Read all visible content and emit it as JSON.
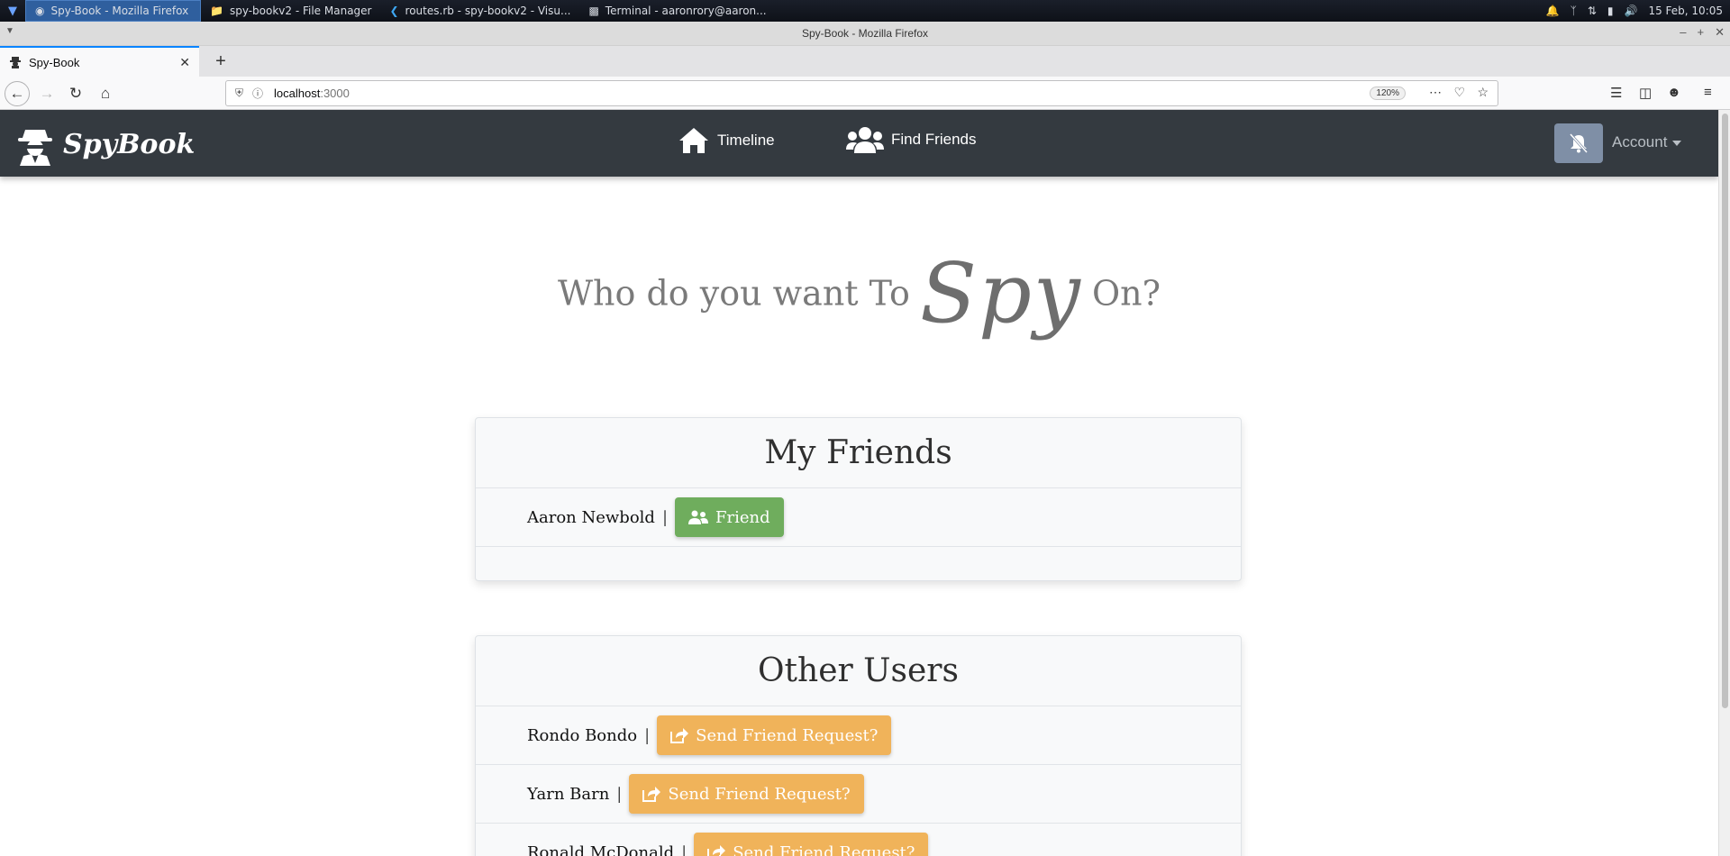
{
  "taskbar": {
    "tasks": [
      {
        "label": "Spy-Book - Mozilla Firefox",
        "icon": "firefox-icon"
      },
      {
        "label": "spy-bookv2 - File Manager",
        "icon": "folder-icon"
      },
      {
        "label": "routes.rb - spy-bookv2 - Visu...",
        "icon": "vscode-icon"
      },
      {
        "label": "Terminal - aaronrory@aaron...",
        "icon": "terminal-icon"
      }
    ],
    "clock": "15 Feb, 10:05"
  },
  "window": {
    "title": "Spy-Book - Mozilla Firefox"
  },
  "browser": {
    "tab_title": "Spy-Book",
    "url_host": "localhost",
    "url_port": ":3000",
    "zoom": "120%"
  },
  "site": {
    "brand": "SpyBook",
    "nav": {
      "timeline": "Timeline",
      "find_friends": "Find Friends",
      "account": "Account"
    }
  },
  "hero": {
    "part1": "Who do you want To",
    "script": "Spy",
    "part2": "On?"
  },
  "friends": {
    "title": "My Friends",
    "items": [
      {
        "name": "Aaron Newbold",
        "button": "Friend"
      }
    ]
  },
  "others": {
    "title": "Other Users",
    "items": [
      {
        "name": "Rondo Bondo",
        "button": "Send Friend Request?"
      },
      {
        "name": "Yarn Barn",
        "button": "Send Friend Request?"
      },
      {
        "name": "Ronald McDonald",
        "button": "Send Friend Request?"
      }
    ]
  },
  "colors": {
    "navbar": "#343a40",
    "friend_button": "#6fad5d",
    "request_button": "#f0b35a",
    "notify_button": "#7f8fa6"
  }
}
